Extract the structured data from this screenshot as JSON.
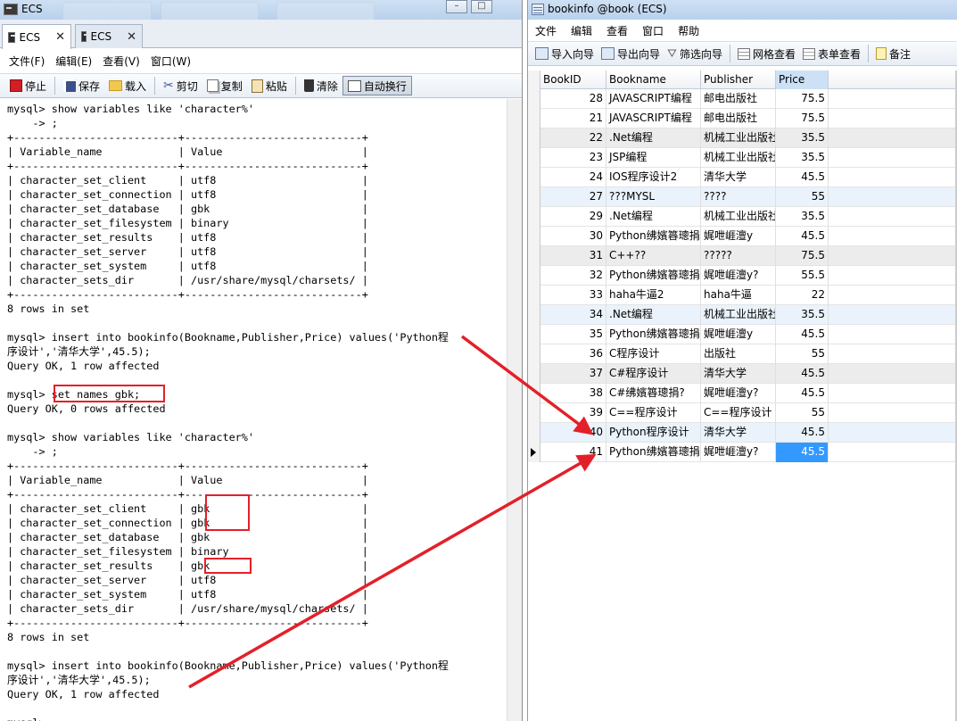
{
  "terminal": {
    "window_title": "ECS",
    "tabs": [
      {
        "label": "ECS",
        "active": true
      },
      {
        "label": "ECS",
        "active": false
      }
    ],
    "menu": [
      "文件(F)",
      "编辑(E)",
      "查看(V)",
      "窗口(W)"
    ],
    "toolbar": {
      "stop": "停止",
      "save": "保存",
      "load": "载入",
      "cut": "剪切",
      "copy": "复制",
      "paste": "粘贴",
      "clear": "清除",
      "autowrap": "自动换行"
    },
    "console_text": "mysql> show variables like 'character%'\n    -> ;\n+--------------------------+----------------------------+\n| Variable_name            | Value                      |\n+--------------------------+----------------------------+\n| character_set_client     | utf8                       |\n| character_set_connection | utf8                       |\n| character_set_database   | gbk                        |\n| character_set_filesystem | binary                     |\n| character_set_results    | utf8                       |\n| character_set_server     | utf8                       |\n| character_set_system     | utf8                       |\n| character_sets_dir       | /usr/share/mysql/charsets/ |\n+--------------------------+----------------------------+\n8 rows in set\n\nmysql> insert into bookinfo(Bookname,Publisher,Price) values('Python程\n序设计','清华大学',45.5);\nQuery OK, 1 row affected\n\nmysql> set names gbk;\nQuery OK, 0 rows affected\n\nmysql> show variables like 'character%'\n    -> ;\n+--------------------------+----------------------------+\n| Variable_name            | Value                      |\n+--------------------------+----------------------------+\n| character_set_client     | gbk                        |\n| character_set_connection | gbk                        |\n| character_set_database   | gbk                        |\n| character_set_filesystem | binary                     |\n| character_set_results    | gbk                        |\n| character_set_server     | utf8                       |\n| character_set_system     | utf8                       |\n| character_sets_dir       | /usr/share/mysql/charsets/ |\n+--------------------------+----------------------------+\n8 rows in set\n\nmysql> insert into bookinfo(Bookname,Publisher,Price) values('Python程\n序设计','清华大学',45.5);\nQuery OK, 1 row affected\n\nmysql> "
  },
  "navicat": {
    "window_title": "bookinfo @book (ECS)",
    "menu": [
      "文件",
      "编辑",
      "查看",
      "窗口",
      "帮助"
    ],
    "toolbar": {
      "import": "导入向导",
      "export": "导出向导",
      "filter": "筛选向导",
      "grid_view": "网格查看",
      "form_view": "表单查看",
      "memo": "备注"
    },
    "columns": [
      "BookID",
      "Bookname",
      "Publisher",
      "Price"
    ],
    "rows": [
      {
        "id": "28",
        "name": "JAVASCRIPT编程",
        "pub": "邮电出版社",
        "price": "75.5"
      },
      {
        "id": "21",
        "name": "JAVASCRIPT编程",
        "pub": "邮电出版社",
        "price": "75.5"
      },
      {
        "id": "22",
        "name": ".Net编程",
        "pub": "机械工业出版社",
        "price": "35.5"
      },
      {
        "id": "23",
        "name": "JSP编程",
        "pub": "机械工业出版社",
        "price": "35.5"
      },
      {
        "id": "24",
        "name": "IOS程序设计2",
        "pub": "清华大学",
        "price": "45.5"
      },
      {
        "id": "27",
        "name": "???MYSL",
        "pub": "????",
        "price": "55"
      },
      {
        "id": "29",
        "name": ".Net编程",
        "pub": "机械工业出版社",
        "price": "35.5"
      },
      {
        "id": "30",
        "name": "Python绋嬪簭璁捐",
        "pub": "娓呭崕澶у",
        "price": "45.5"
      },
      {
        "id": "31",
        "name": "C++??",
        "pub": "?????",
        "price": "75.5"
      },
      {
        "id": "32",
        "name": "Python绋嬪簭璁捐",
        "pub": "娓呭崕澶у?",
        "price": "55.5"
      },
      {
        "id": "33",
        "name": "haha牛逼2",
        "pub": "haha牛逼",
        "price": "22"
      },
      {
        "id": "34",
        "name": ".Net编程",
        "pub": "机械工业出版社",
        "price": "35.5"
      },
      {
        "id": "35",
        "name": "Python绋嬪簭璁捐",
        "pub": "娓呭崕澶у",
        "price": "45.5"
      },
      {
        "id": "36",
        "name": "C程序设计",
        "pub": "出版社",
        "price": "55"
      },
      {
        "id": "37",
        "name": "C#程序设计",
        "pub": "清华大学",
        "price": "45.5"
      },
      {
        "id": "38",
        "name": "C#绋嬪簭璁捐?",
        "pub": "娓呭崕澶у?",
        "price": "45.5"
      },
      {
        "id": "39",
        "name": "C==程序设计",
        "pub": "C==程序设计",
        "price": "55"
      },
      {
        "id": "40",
        "name": "Python程序设计",
        "pub": "清华大学",
        "price": "45.5"
      },
      {
        "id": "41",
        "name": "Python绋嬪簭璁捐",
        "pub": "娓呭崕澶у?",
        "price": "45.5"
      }
    ]
  },
  "colors": {
    "highlight_red": "#e3202a",
    "selection_blue": "#3399ff",
    "title_bar": "#c4d8ee"
  }
}
